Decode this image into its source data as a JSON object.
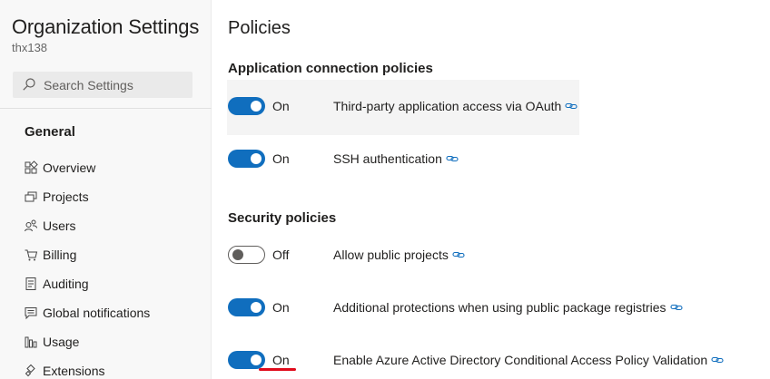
{
  "sidebar": {
    "title": "Organization Settings",
    "org_name": "thx138",
    "search_placeholder": "Search Settings",
    "group_title": "General",
    "items": [
      {
        "label": "Overview",
        "icon": "overview-icon"
      },
      {
        "label": "Projects",
        "icon": "projects-icon"
      },
      {
        "label": "Users",
        "icon": "users-icon"
      },
      {
        "label": "Billing",
        "icon": "billing-icon"
      },
      {
        "label": "Auditing",
        "icon": "auditing-icon"
      },
      {
        "label": "Global notifications",
        "icon": "notifications-icon"
      },
      {
        "label": "Usage",
        "icon": "usage-icon"
      },
      {
        "label": "Extensions",
        "icon": "extensions-icon"
      }
    ]
  },
  "main": {
    "title": "Policies",
    "sections": [
      {
        "title": "Application connection policies",
        "policies": [
          {
            "state": "On",
            "enabled": true,
            "label": "Third-party application access via OAuth"
          },
          {
            "state": "On",
            "enabled": true,
            "label": "SSH authentication"
          }
        ]
      },
      {
        "title": "Security policies",
        "policies": [
          {
            "state": "Off",
            "enabled": false,
            "label": "Allow public projects"
          },
          {
            "state": "On",
            "enabled": true,
            "label": "Additional protections when using public package registries"
          },
          {
            "state": "On",
            "enabled": true,
            "label": "Enable Azure Active Directory Conditional Access Policy Validation"
          }
        ]
      }
    ]
  },
  "colors": {
    "toggle_on": "#106ebe",
    "toggle_off_border": "#605e5c",
    "annotation_underline": "#e00b1c",
    "link_icon": "#106ebe"
  }
}
